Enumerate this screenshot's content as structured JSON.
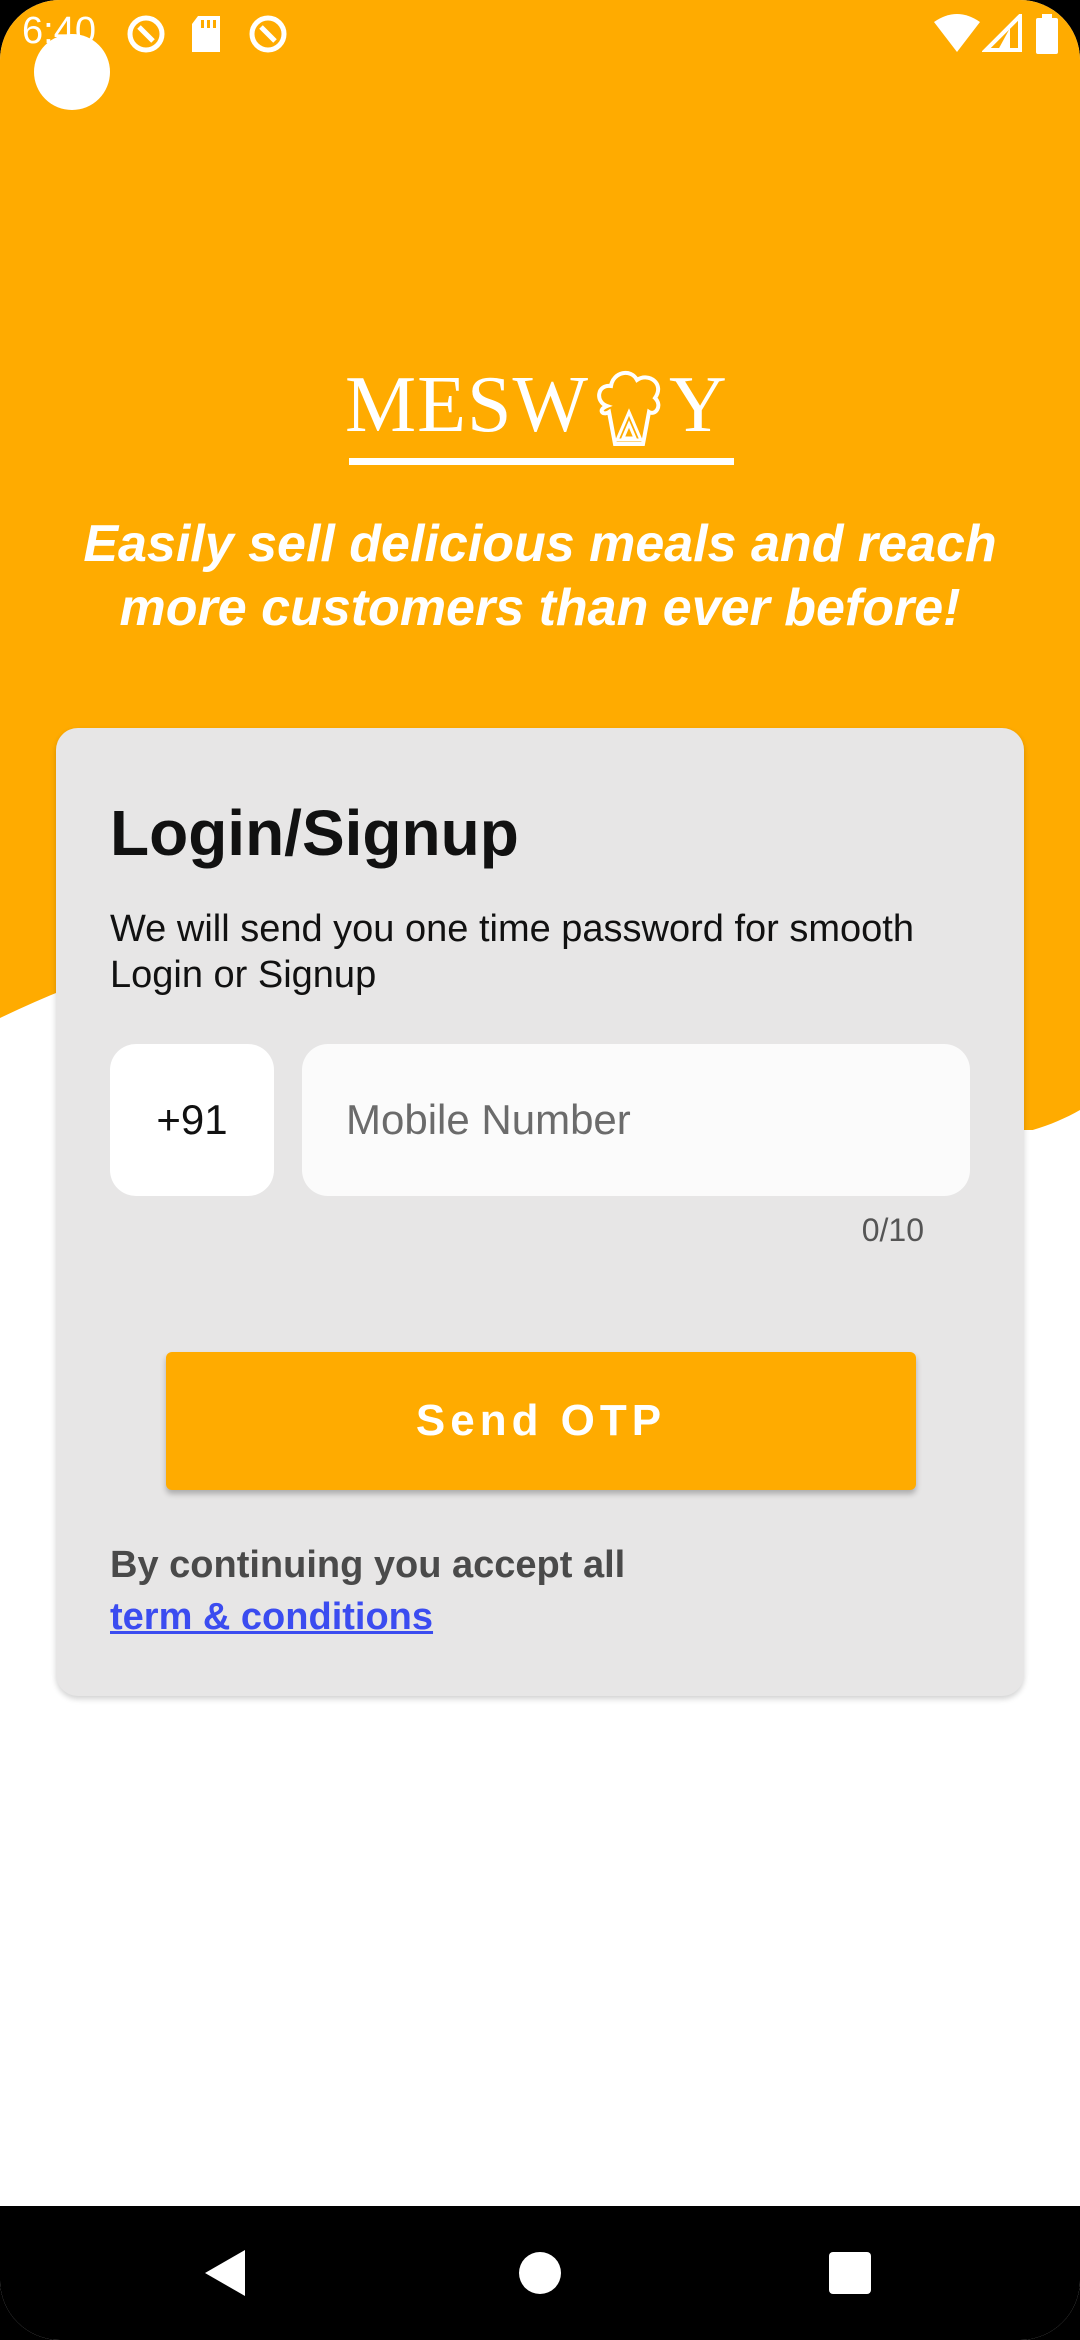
{
  "status_bar": {
    "time": "6:40",
    "icons": [
      "notification-icon",
      "sd-card-icon",
      "notification-icon",
      "wifi-icon",
      "cellular-signal-icon",
      "battery-icon"
    ]
  },
  "brand": {
    "logo_text_left": "MESW",
    "logo_text_right": "Y",
    "logo_icon": "chef-hat-icon"
  },
  "hero": {
    "tagline": "Easily sell delicious meals and reach more customers than ever before!"
  },
  "login_card": {
    "title": "Login/Signup",
    "description": "We will send you one time password for smooth Login or Signup",
    "country_code": "+91",
    "mobile_placeholder": "Mobile Number",
    "mobile_value": "",
    "char_counter": "0/10",
    "send_button_label": "Send OTP",
    "terms_prefix": "By continuing you accept all",
    "terms_link": "term & conditions "
  },
  "nav_bar": {
    "back": "back-icon",
    "home": "home-icon",
    "recents": "recents-icon"
  },
  "colors": {
    "accent": "#ffab00",
    "card": "#e7e6e6",
    "link": "#3b4cf0",
    "background": "#ffffff"
  }
}
